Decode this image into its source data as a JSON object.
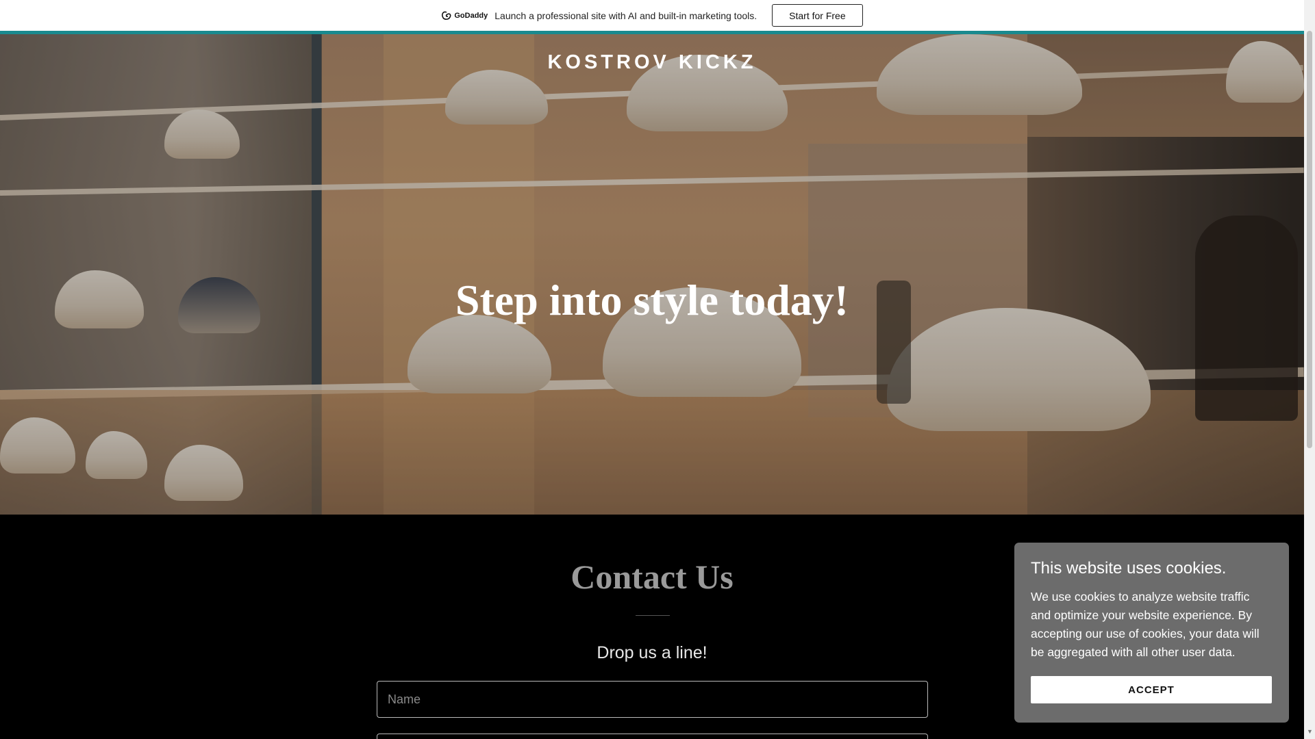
{
  "promo": {
    "logo_text": "GoDaddy",
    "message": "Launch a professional site with AI and built-in marketing tools.",
    "button_label": "Start for Free"
  },
  "hero": {
    "brand": "KOSTROV KICKZ",
    "headline": "Step into style today!"
  },
  "contact": {
    "title": "Contact Us",
    "subtitle": "Drop us a line!",
    "name_placeholder": "Name"
  },
  "cookie": {
    "title": "This website uses cookies.",
    "body": "We use cookies to analyze website traffic and optimize your website experience. By accepting our use of cookies, your data will be aggregated with all other user data.",
    "accept_label": "ACCEPT"
  },
  "colors": {
    "accent_line": "#1a8a8f",
    "cookie_bg": "#6c6c6c"
  }
}
